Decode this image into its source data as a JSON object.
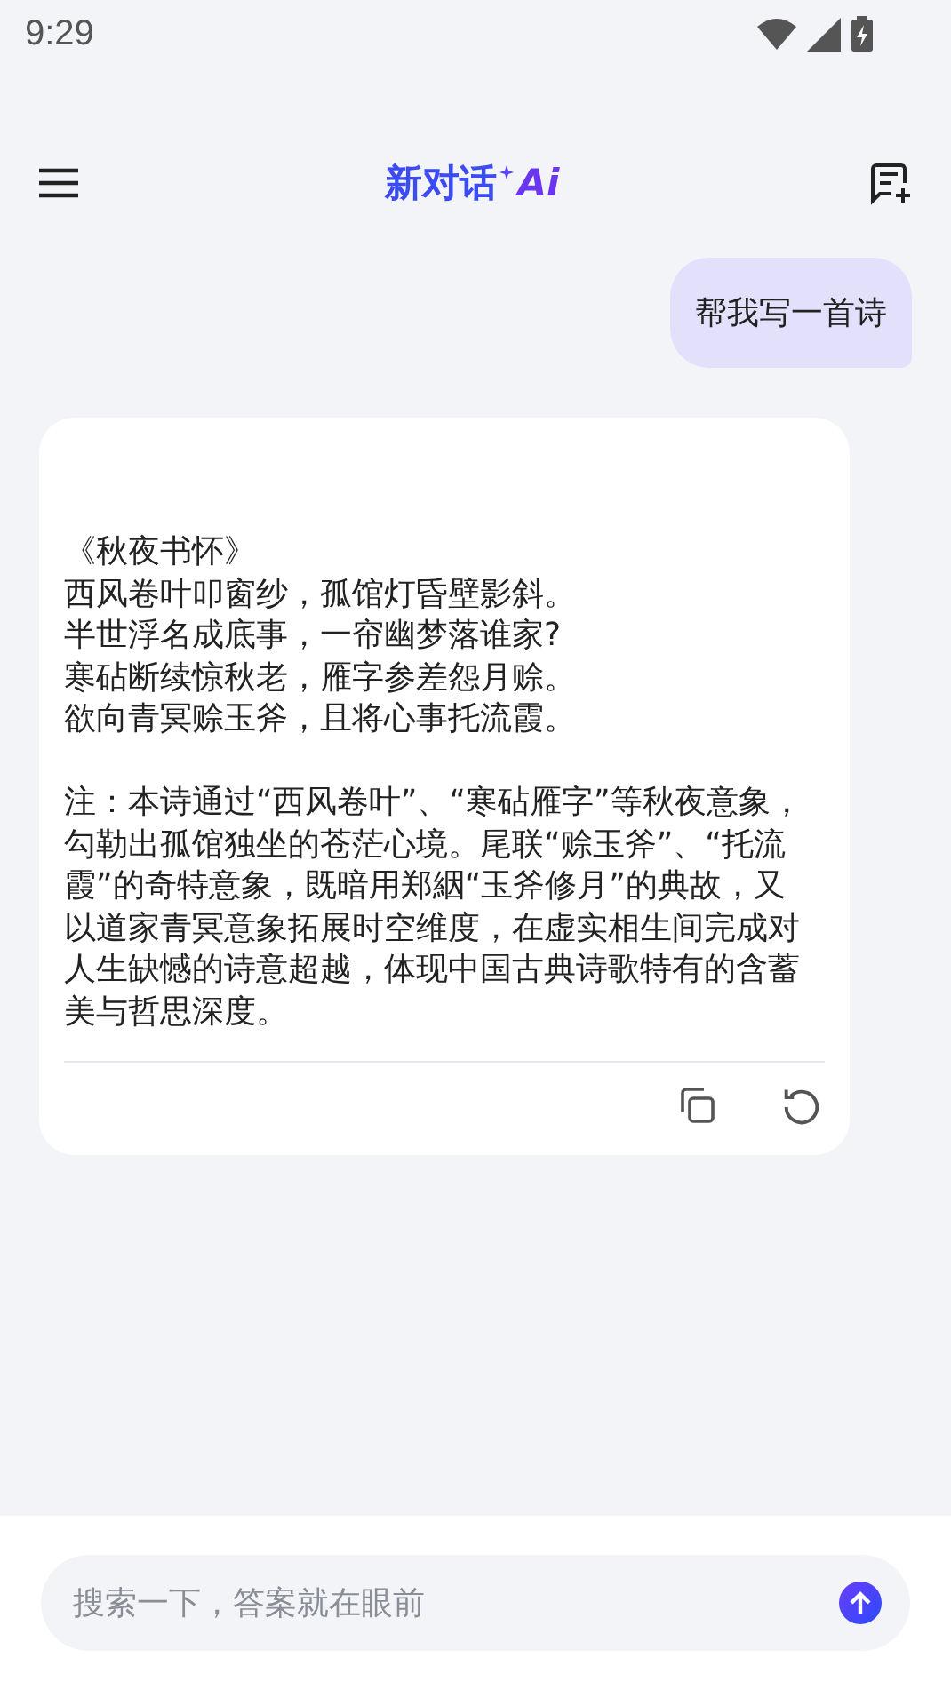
{
  "status_bar": {
    "time": "9:29"
  },
  "header": {
    "title": "新对话",
    "logo": "Ai"
  },
  "messages": [
    {
      "kind": "user",
      "text": "帮我写一首诗"
    },
    {
      "kind": "assistant",
      "lines": [
        "《秋夜书怀》",
        "西风卷叶叩窗纱，孤馆灯昏壁影斜。",
        "半世浮名成底事，一帘幽梦落谁家?",
        "寒砧断续惊秋老，雁字参差怨月赊。",
        "欲向青冥赊玉斧，且将心事托流霞。"
      ],
      "note": "注：本诗通过“西风卷叶”、“寒砧雁字”等秋夜意象，勾勒出孤馆独坐的苍茫心境。尾联“赊玉斧”、“托流霞”的奇特意象，既暗用郑絪“玉斧修月”的典故，又以道家青冥意象拓展时空维度，在虚实相生间完成对人生缺憾的诗意超越，体现中国古典诗歌特有的含蓄美与哲思深度。"
    }
  ],
  "input": {
    "placeholder": "搜索一下，答案就在眼前"
  }
}
